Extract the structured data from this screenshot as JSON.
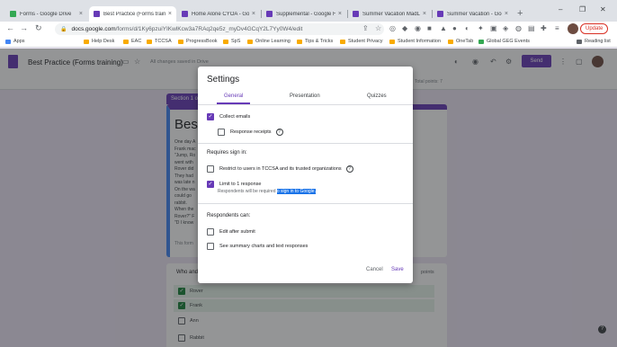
{
  "browser": {
    "tabs": [
      {
        "title": "Forms - Google Drive",
        "fav": "#34a853"
      },
      {
        "title": "Best Practice (Forms training",
        "fav": "#673ab7",
        "active": true
      },
      {
        "title": "Home Alone CYOA - Goog",
        "fav": "#673ab7"
      },
      {
        "title": "Supplemental - Google Fo",
        "fav": "#673ab7"
      },
      {
        "title": "Summer Vacation MadLib",
        "fav": "#673ab7"
      },
      {
        "title": "Summer Vacation - Googl",
        "fav": "#673ab7"
      }
    ],
    "url_domain": "docs.google.com",
    "url_path": "/forms/d/1Ky6pzuiYIKwlKcw3a7RAq2qe5z_myDv4GCqY2L7Yy0W4/edit",
    "update_label": "Update",
    "bookmarks": [
      "Apps",
      "Help Desk",
      "EAC",
      "TCCSA",
      "ProgressBook",
      "SpS",
      "Online Learning",
      "Tips & Tricks",
      "Student Privacy",
      "Student Information",
      "OneTab",
      "Global GEG Events",
      "Reading list"
    ]
  },
  "forms": {
    "title": "Best Practice (Forms training)",
    "saved_text": "All changes saved in Drive",
    "send_label": "Send",
    "total_points": "Total points: 7"
  },
  "form_body": {
    "section_label": "Section 1 o",
    "title": "Best",
    "description_lines": [
      "One day A",
      "Frank mac",
      "\"Jump, Ro",
      "went with",
      "Rover did",
      "They had",
      "was late n",
      "On the wa",
      "could go",
      "rabbit.",
      "When the",
      "Rover?\" F",
      "\"D I know"
    ],
    "footer": "This form",
    "question_label": "Who and",
    "points_label": "points",
    "options": [
      {
        "label": "Rover",
        "correct": true
      },
      {
        "label": "Frank",
        "correct": true
      },
      {
        "label": "Ann",
        "correct": false
      },
      {
        "label": "Rabbit",
        "correct": false
      }
    ]
  },
  "dialog": {
    "title": "Settings",
    "tabs": [
      "General",
      "Presentation",
      "Quizzes"
    ],
    "collect_emails": {
      "label": "Collect emails",
      "checked": true
    },
    "response_receipts": {
      "label": "Response receipts",
      "checked": false
    },
    "requires_sign_in": "Requires sign in:",
    "restrict_users": {
      "label": "Restrict to users in TCCSA and its trusted organizations",
      "checked": false
    },
    "limit_one": {
      "label": "Limit to 1 response",
      "checked": true
    },
    "limit_sub_plain": "Respondents will be required ",
    "limit_sub_highlight": "o sign in to Google.",
    "respondents_can": "Respondents can:",
    "edit_after": {
      "label": "Edit after submit",
      "checked": false
    },
    "summary_charts": {
      "label": "See summary charts and text responses",
      "checked": false
    },
    "cancel_label": "Cancel",
    "save_label": "Save"
  },
  "colors": {
    "accent": "#673ab7",
    "correct": "#188038",
    "highlight": "#1a73e8"
  }
}
